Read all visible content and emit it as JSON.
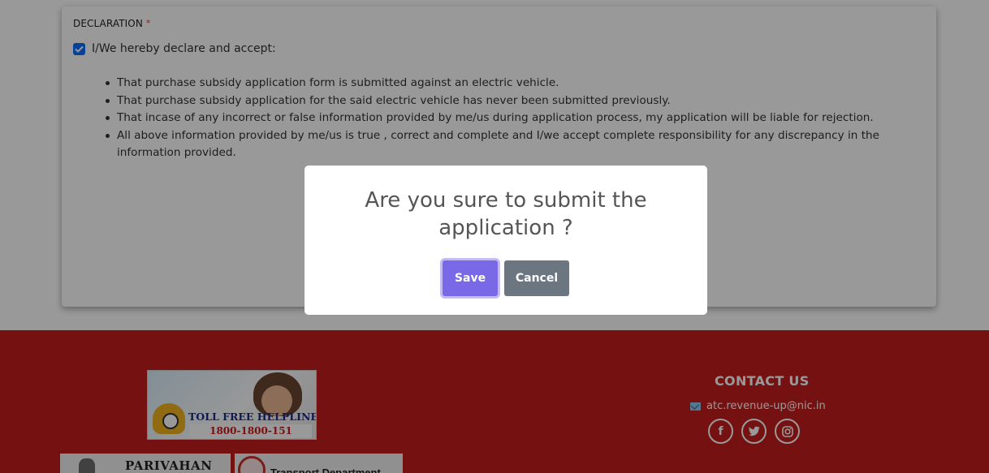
{
  "declaration": {
    "title": "DECLARATION",
    "required_mark": "*",
    "checkbox_label": "I/We hereby declare and accept:",
    "checked": true,
    "items": [
      "That purchase subsidy application form is submitted against an electric vehicle.",
      "That purchase subsidy application for the said electric vehicle has never been submitted previously.",
      "That incase of any incorrect or false information provided by me/us during application process, my application will be liable for rejection.",
      "All above information provided by me/us is true , correct and complete and I/we accept complete responsibility for any discrepancy in the information provided."
    ]
  },
  "modal": {
    "title": "Are you sure to submit the application ?",
    "save_label": "Save",
    "cancel_label": "Cancel"
  },
  "footer": {
    "helpline_text": "TOLL FREE HELPLINE",
    "helpline_number": "1800-1800-151",
    "parivahan_text": "PARIVAHAN",
    "transport_text": "Transport Department",
    "contact_title": "CONTACT US",
    "email": "atc.revenue-up@nic.in",
    "socials": [
      "facebook-icon",
      "twitter-icon",
      "instagram-icon"
    ]
  },
  "colors": {
    "footer_bg": "#c51d1d",
    "save_button": "#7a69e6",
    "cancel_button": "#6c7680",
    "checkbox": "#0d6efd"
  }
}
